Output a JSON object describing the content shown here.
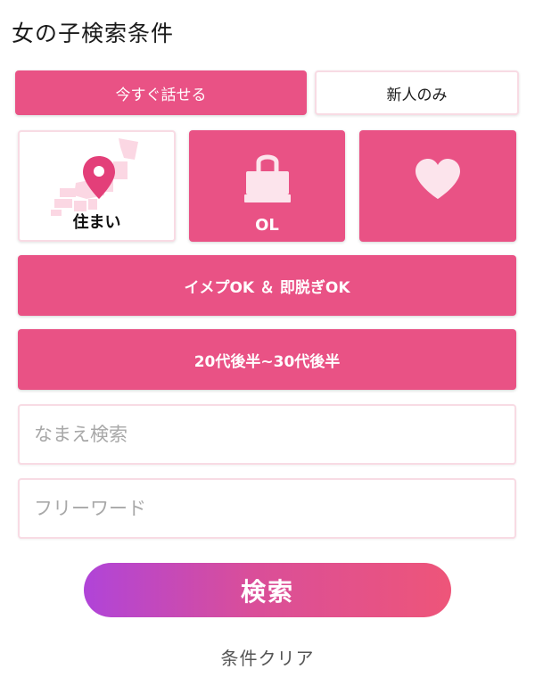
{
  "page": {
    "title": "女の子検索条件"
  },
  "toggles": {
    "now_label": "今すぐ話せる",
    "newbie_label": "新人のみ"
  },
  "tiles": [
    {
      "label": "住まい",
      "icon": "japan-map-pin-icon"
    },
    {
      "label": "OL",
      "icon": "shopping-bag-icon"
    },
    {
      "label": "",
      "icon": "heart-icon"
    }
  ],
  "filters": {
    "tags_label": "イメプOK ＆ 即脱ぎOK",
    "age_label": "20代後半~30代後半"
  },
  "inputs": {
    "name": {
      "placeholder": "なまえ検索",
      "value": ""
    },
    "freeword": {
      "placeholder": "フリーワード",
      "value": ""
    }
  },
  "actions": {
    "search_label": "検索",
    "clear_label": "条件クリア"
  },
  "colors": {
    "accent": "#e95285",
    "border": "#f8dbe4",
    "gradient_start": "#b044d8",
    "gradient_end": "#ee5579"
  }
}
